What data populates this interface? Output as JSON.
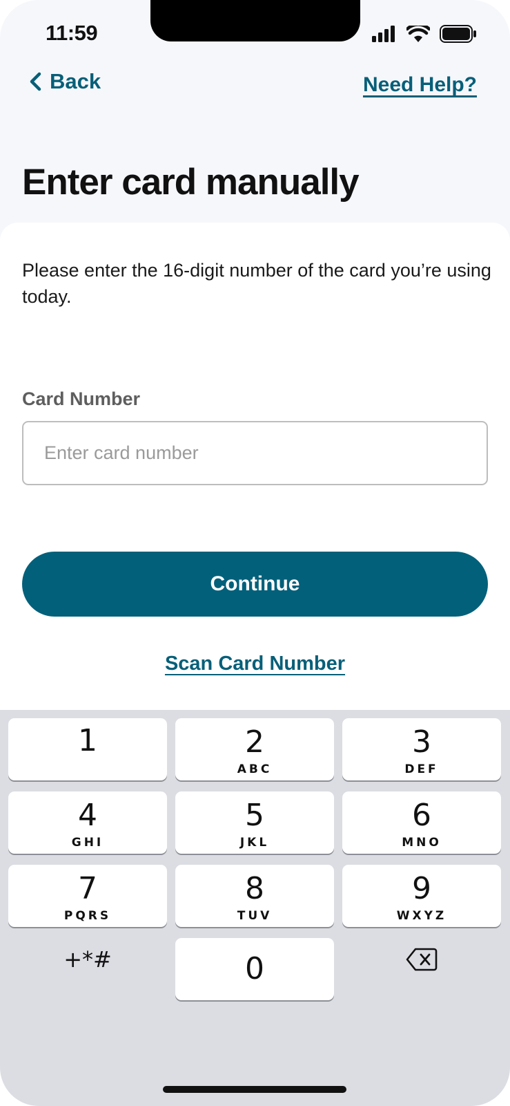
{
  "status": {
    "time": "11:59"
  },
  "nav": {
    "back_label": "Back",
    "help_label": "Need Help?"
  },
  "page": {
    "title": "Enter card manually",
    "instruction": "Please enter the 16-digit number of the card you’re using today."
  },
  "form": {
    "card_label": "Card Number",
    "card_placeholder": "Enter card number",
    "card_value": "",
    "continue_label": "Continue",
    "scan_label": "Scan Card Number"
  },
  "keyboard": {
    "keys": [
      {
        "digit": "1",
        "letters": ""
      },
      {
        "digit": "2",
        "letters": "ABC"
      },
      {
        "digit": "3",
        "letters": "DEF"
      },
      {
        "digit": "4",
        "letters": "GHI"
      },
      {
        "digit": "5",
        "letters": "JKL"
      },
      {
        "digit": "6",
        "letters": "MNO"
      },
      {
        "digit": "7",
        "letters": "PQRS"
      },
      {
        "digit": "8",
        "letters": "TUV"
      },
      {
        "digit": "9",
        "letters": "WXYZ"
      },
      {
        "digit": "0",
        "letters": ""
      }
    ],
    "symbols_label": "+*#"
  },
  "colors": {
    "accent": "#02607a",
    "link": "#075f78",
    "keyboard_bg": "#dcdde2",
    "page_bg": "#f6f7fb"
  },
  "icons": {
    "back": "chevron-left-icon",
    "signal": "cellular-signal-icon",
    "wifi": "wifi-icon",
    "battery": "battery-icon",
    "delete": "backspace-icon"
  }
}
